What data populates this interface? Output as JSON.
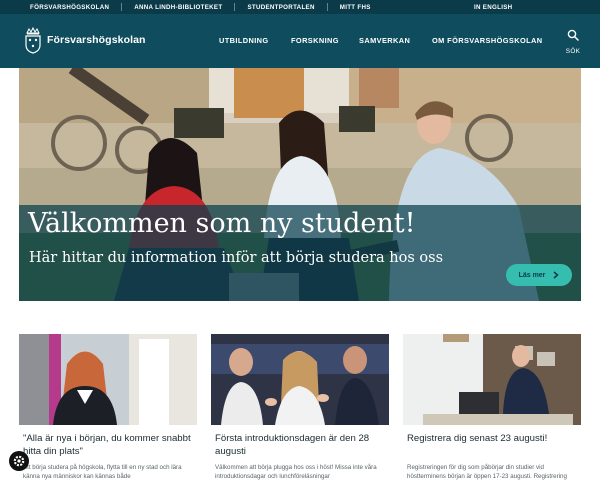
{
  "topbar": {
    "links": [
      "FÖRSVARSHÖGSKOLAN",
      "ANNA LINDH-BIBLIOTEKET",
      "STUDENTPORTALEN",
      "MITT FHS"
    ],
    "language": "IN ENGLISH"
  },
  "header": {
    "logo_text": "Försvarshögskolan",
    "nav": [
      "UTBILDNING",
      "FORSKNING",
      "SAMVERKAN",
      "OM FÖRSVARSHÖGSKOLAN"
    ],
    "search_label": "SÖK"
  },
  "hero": {
    "title": "Välkommen som ny student!",
    "subtitle": "Här hittar du information inför att börja studera hos oss",
    "button_label": "Läs mer"
  },
  "cards": [
    {
      "title": "\"Alla är nya i början, du kommer snabbt hitta din plats\"",
      "excerpt": "Att börja studera på högskola, flytta till en ny stad och lära känna nya människor kan kännas både"
    },
    {
      "title": "Första introduktionsdagen är den 28 augusti",
      "excerpt": "Välkommen att börja plugga hos oss i höst! Missa inte våra introduktionsdagar och lunchföreläsningar"
    },
    {
      "title": "Registrera dig senast 23 augusti!",
      "excerpt": "Registreringen för dig som påbörjar din studier vid höstterminens början är öppen 17-23 augusti. Registrering är obligatoriskt och krävs för att du ska få"
    }
  ],
  "colors": {
    "topbar": "#0b3a48",
    "header": "#0f4d5e",
    "accent_button": "#35bdb0",
    "hero_overlay": "#0a3e4e"
  },
  "icons": {
    "logo": "crown-shield-icon",
    "search": "search-icon",
    "arrow": "chevron-right-icon",
    "cookie": "cookie-settings-icon"
  }
}
